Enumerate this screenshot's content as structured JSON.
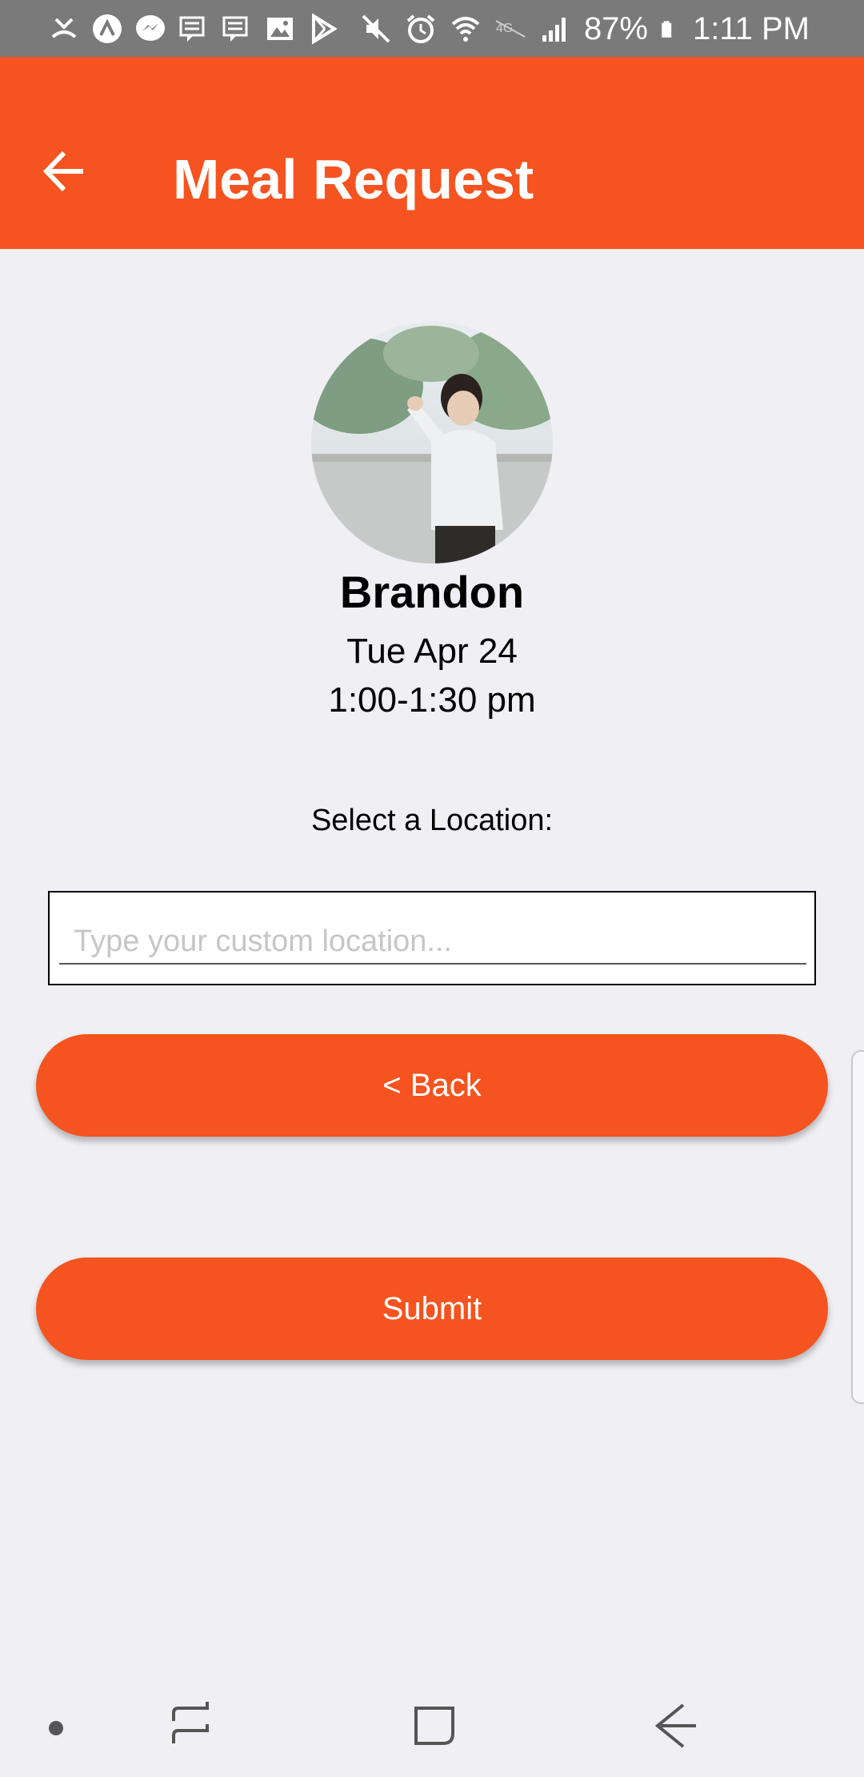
{
  "status_bar": {
    "battery": "87%",
    "time": "1:11 PM",
    "left_icons": [
      "missed-call-icon",
      "app-icon",
      "messenger-icon",
      "message-icon",
      "message-icon",
      "image-icon",
      "play-store-icon"
    ],
    "right_icons": [
      "mute-icon",
      "alarm-icon",
      "wifi-icon",
      "4g-icon",
      "signal-icon",
      "battery-icon"
    ]
  },
  "app_bar": {
    "title": "Meal Request",
    "back_icon": "arrow-left-icon",
    "color": "#f5531f"
  },
  "profile": {
    "name": "Brandon",
    "date": "Tue Apr 24",
    "time": "1:00-1:30 pm"
  },
  "location": {
    "label": "Select a Location:",
    "placeholder": "Type your custom location...",
    "value": ""
  },
  "buttons": {
    "back": "< Back",
    "submit": "Submit"
  },
  "nav_bar": {
    "icons": [
      "dot-icon",
      "recent-apps-icon",
      "home-icon",
      "back-icon"
    ]
  },
  "colors": {
    "accent": "#f5531f",
    "background": "#efeff4"
  }
}
